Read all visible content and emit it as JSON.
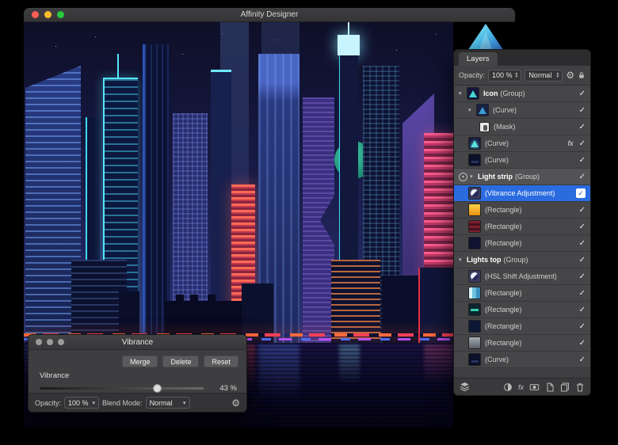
{
  "window": {
    "title": "Affinity Designer"
  },
  "colors": {
    "selection_blue": "#2a6be0",
    "traffic_red": "#ff5f57",
    "traffic_yellow": "#febc2e",
    "traffic_green": "#28c840"
  },
  "icons": {
    "check": "✓",
    "fx": "fx",
    "disclosure": "▾",
    "dropdown": "▾",
    "stepper_up": "▴",
    "stepper_down": "▾",
    "gear": "⚙"
  },
  "layers_panel": {
    "tab": "Layers",
    "opacity_label": "Opacity:",
    "opacity_value": "100 %",
    "blend_value": "Normal",
    "rows": [
      {
        "name": "Icon",
        "type": "(Group)"
      },
      {
        "type": "(Curve)"
      },
      {
        "type": "(Mask)"
      },
      {
        "type": "(Curve)"
      },
      {
        "type": "(Curve)"
      },
      {
        "name": "Light strip",
        "type": "(Group)"
      },
      {
        "type": "(Vibrance Adjustment)"
      },
      {
        "type": "(Rectangle)"
      },
      {
        "type": "(Rectangle)"
      },
      {
        "type": "(Rectangle)"
      },
      {
        "name": "Lights top",
        "type": "(Group)"
      },
      {
        "type": "(HSL Shift Adjustment)"
      },
      {
        "type": "(Rectangle)"
      },
      {
        "type": "(Rectangle)"
      },
      {
        "type": "(Rectangle)"
      },
      {
        "type": "(Rectangle)"
      },
      {
        "type": "(Curve)"
      }
    ]
  },
  "vibrance_dialog": {
    "title": "Vibrance",
    "merge": "Merge",
    "delete": "Delete",
    "reset": "Reset",
    "slider_label": "Vibrance",
    "slider_value": "43 %",
    "opacity_label": "Opacity:",
    "opacity_value": "100 %",
    "blend_label": "Blend Mode:",
    "blend_value": "Normal"
  }
}
